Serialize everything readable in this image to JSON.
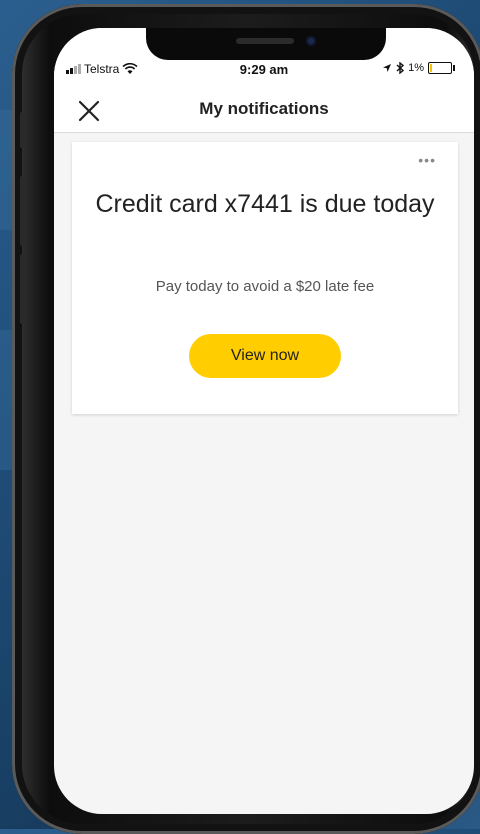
{
  "status_bar": {
    "carrier": "Telstra",
    "time": "9:29 am",
    "battery": "1%"
  },
  "header": {
    "title": "My notifications",
    "close_icon": "close-icon"
  },
  "notification": {
    "title": "Credit card x7441 is due today",
    "subtitle": "Pay today to avoid a $20 late fee",
    "button_label": "View now",
    "more_label": "•••"
  },
  "colors": {
    "accent": "#ffcd00",
    "screen_bg": "#f5f5f5"
  }
}
